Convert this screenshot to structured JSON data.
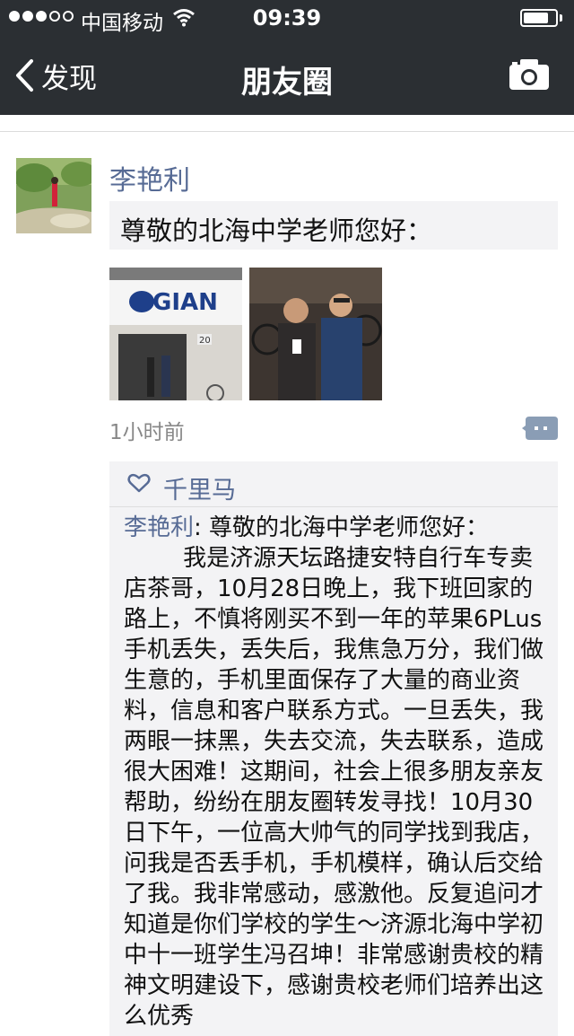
{
  "status_bar": {
    "carrier": "中国移动",
    "time": "09:39",
    "signal_bars_filled": 3,
    "signal_bars_total": 5
  },
  "nav": {
    "back_label": "发现",
    "title": "朋友圈"
  },
  "post": {
    "author": "李艳利",
    "share_text": "尊敬的北海中学老师您好：",
    "time_ago": "1小时前",
    "photo_sign": "GIAN",
    "photo_number": "20"
  },
  "likes": {
    "names": "千里马"
  },
  "comment": {
    "author": "李艳利",
    "separator": ": ",
    "body": "尊敬的北海中学老师您好：\n        我是济源天坛路捷安特自行车专卖店茶哥，10月28日晚上，我下班回家的路上，不慎将刚买不到一年的苹果6PLus手机丢失，丢失后，我焦急万分，我们做生意的，手机里面保存了大量的商业资料，信息和客户联系方式。一旦丢失，我两眼一抹黑，失去交流，失去联系，造成很大困难！这期间，社会上很多朋友亲友帮助，纷纷在朋友圈转发寻找！10月30日下午，一位高大帅气的同学找到我店，问我是否丢手机，手机模样，确认后交给了我。我非常感动，感激他。反复追问才知道是你们学校的学生～济源北海中学初中十一班学生冯召坤！非常感谢贵校的精神文明建设下，感谢贵校老师们培养出这么优秀"
  },
  "colors": {
    "header_bg": "#2b2f33",
    "name_link": "#576b95",
    "card_bg": "#f3f3f5"
  },
  "icons": [
    "back-chevron-icon",
    "camera-icon",
    "wifi-icon",
    "heart-icon",
    "comment-more-icon"
  ]
}
